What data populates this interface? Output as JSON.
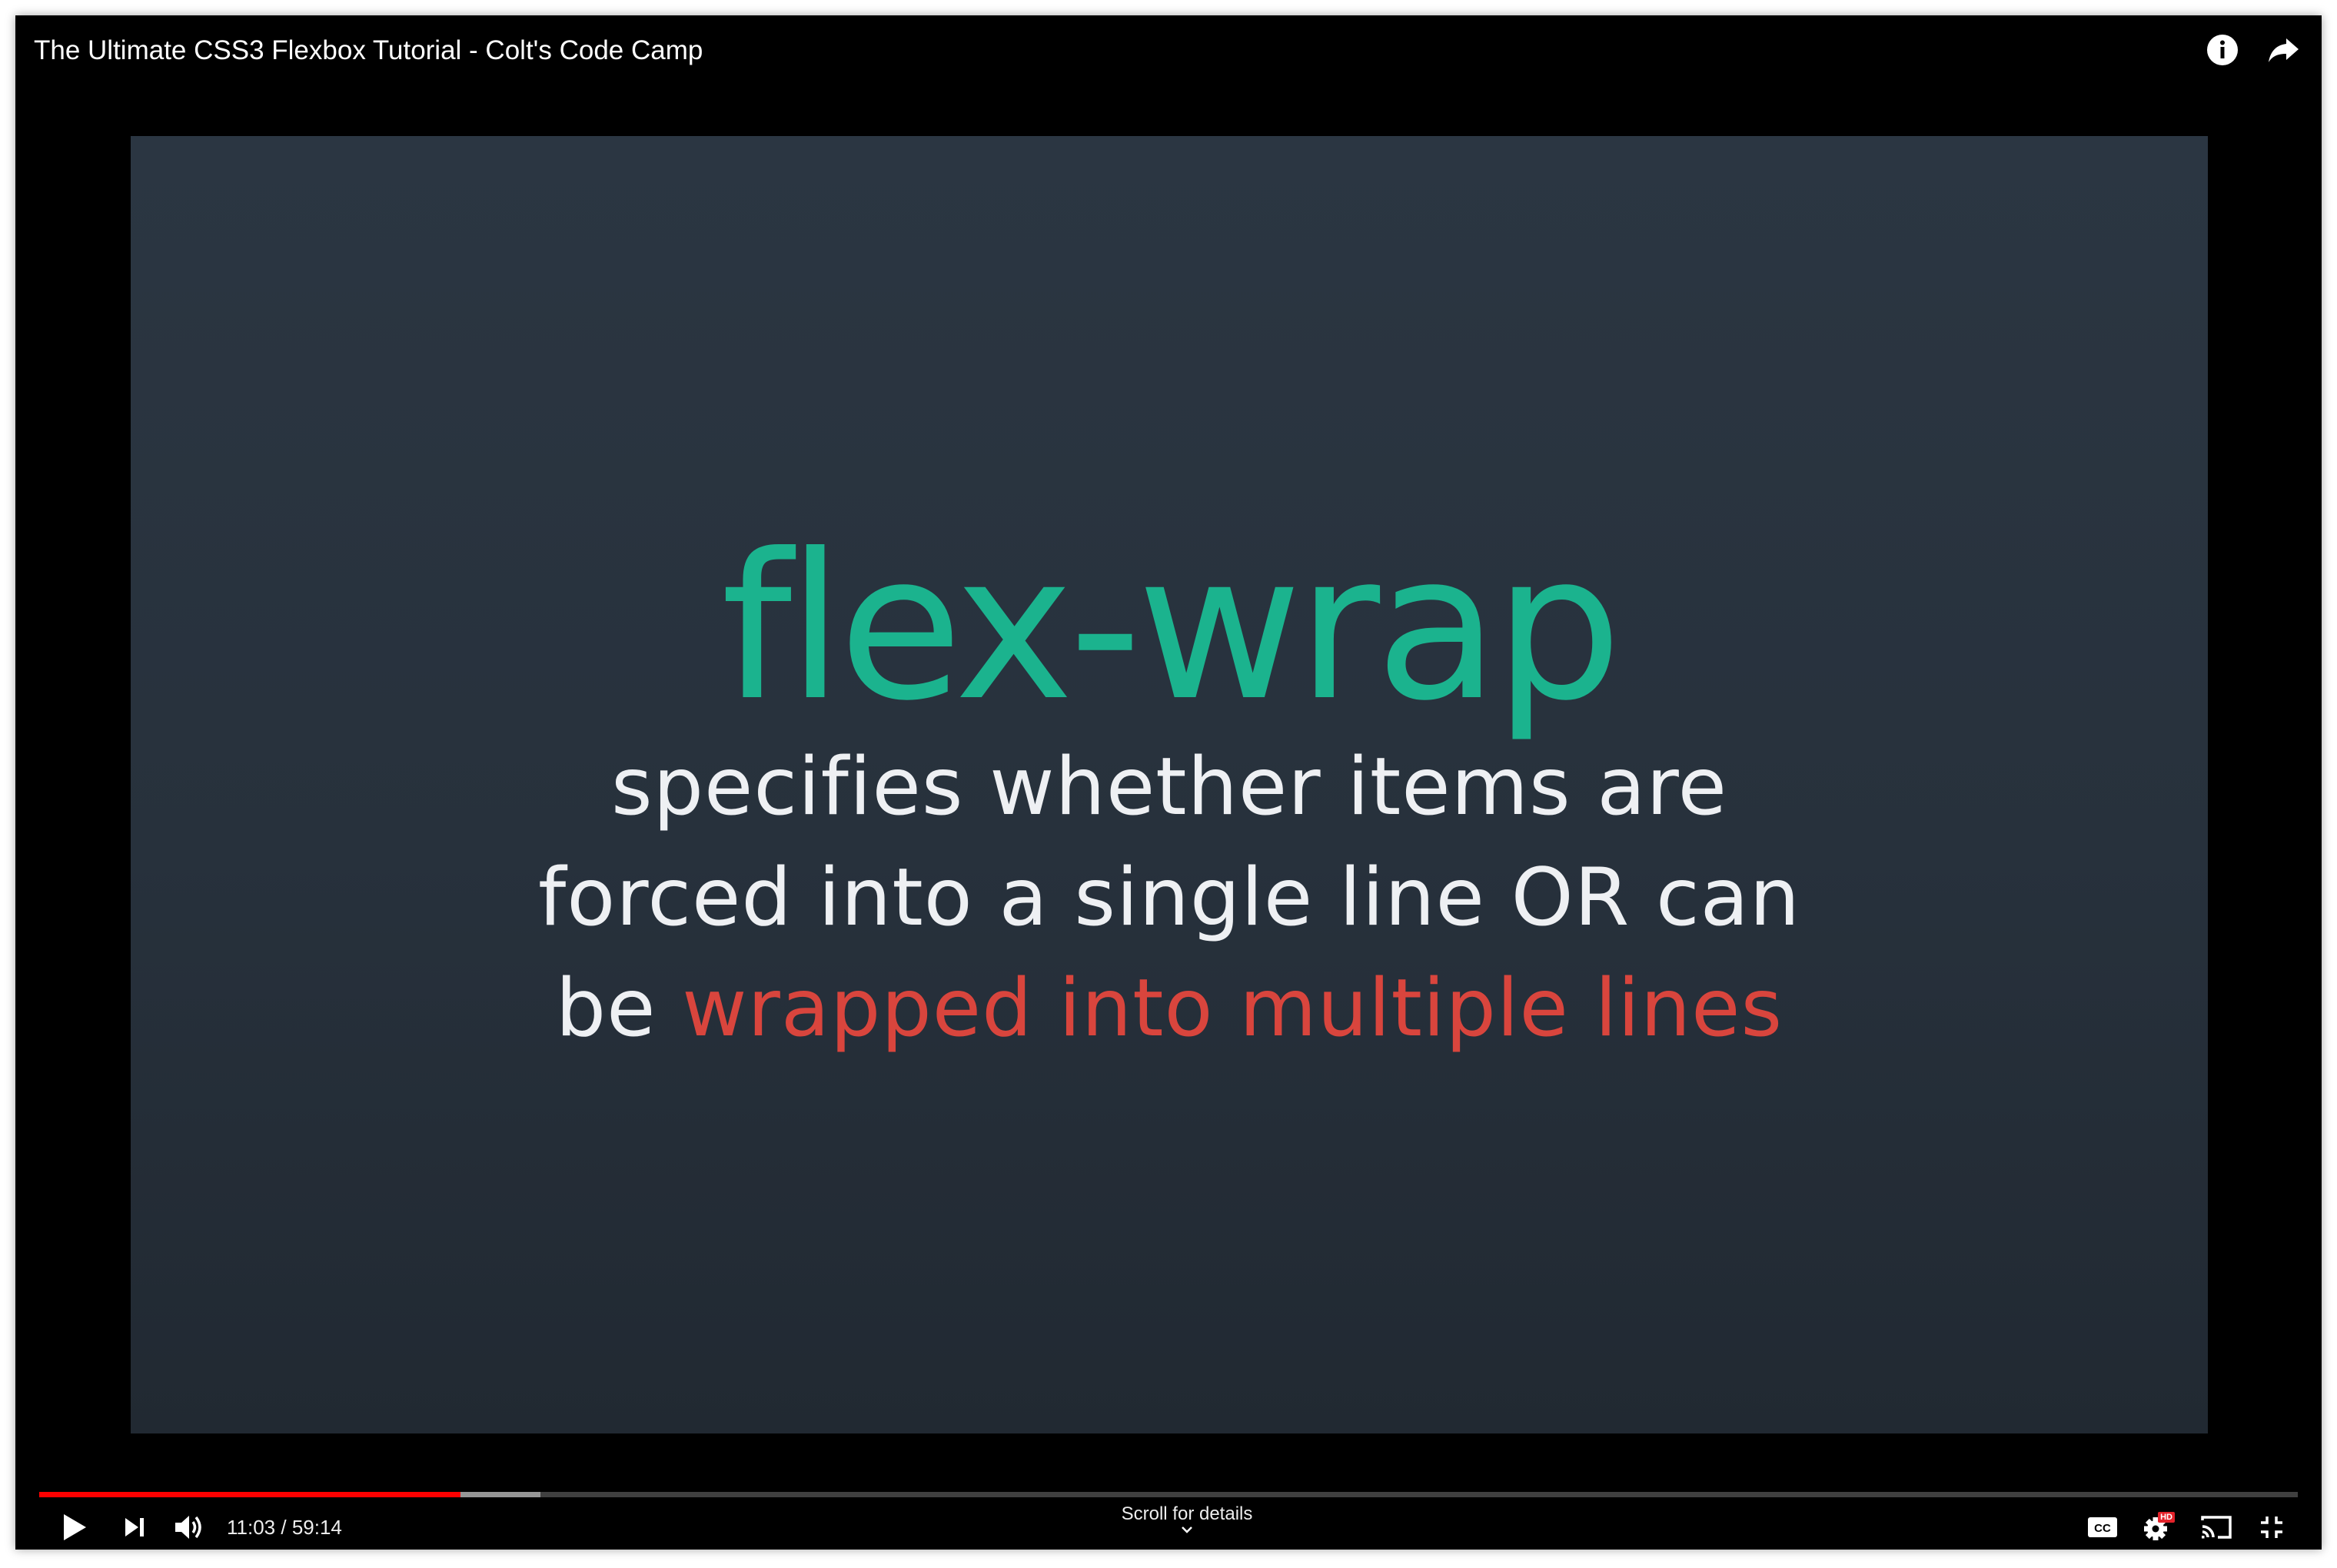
{
  "video_title": "The Ultimate CSS3 Flexbox Tutorial - Colt's Code Camp",
  "slide": {
    "heading": "flex-wrap",
    "line1": "specifies whether items are",
    "line2": "forced into a single line OR can",
    "line3_plain": "be ",
    "line3_highlight": "wrapped into multiple lines"
  },
  "colors": {
    "heading": "#1bb38e",
    "body_text": "#eef0f3",
    "highlight": "#d9453d",
    "progress_played": "#ff0000",
    "hd_badge": "#e3222a"
  },
  "playback": {
    "current_time": "11:03",
    "separator": " / ",
    "duration": "59:14",
    "played_fraction": 0.1866,
    "buffered_fraction": 0.222
  },
  "scroll_hint": "Scroll for details",
  "badges": {
    "hd": "HD"
  },
  "icons": {
    "info": "info-icon",
    "share": "share-icon",
    "play": "play-icon",
    "next": "skip-next-icon",
    "volume": "volume-icon",
    "captions": "closed-captions-icon",
    "settings": "settings-gear-icon",
    "cast": "cast-icon",
    "exit_fullscreen": "exit-fullscreen-icon",
    "chevron": "chevron-down-icon"
  }
}
